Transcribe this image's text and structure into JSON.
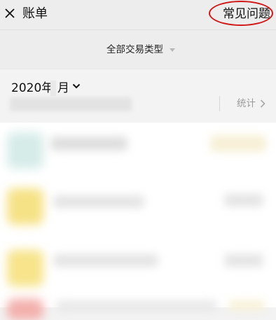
{
  "header": {
    "title": "账单",
    "faq_label": "常见问题",
    "close_icon": "close-icon"
  },
  "filter": {
    "label": "全部交易类型",
    "caret_icon": "caret-down-icon"
  },
  "month_selector": {
    "year_text": "2020年",
    "month_text": "月",
    "chevron_icon": "chevron-down-icon"
  },
  "statistics": {
    "label": "统计",
    "arrow_icon": "chevron-right-icon"
  },
  "colors": {
    "annotation_circle": "#d11818",
    "avatar_1": "#d6ece9",
    "avatar_2": "#f6e286",
    "avatar_3": "#f7e48b",
    "avatar_4": "#f3b0ac",
    "amount_tint": "#f7f0d6"
  }
}
